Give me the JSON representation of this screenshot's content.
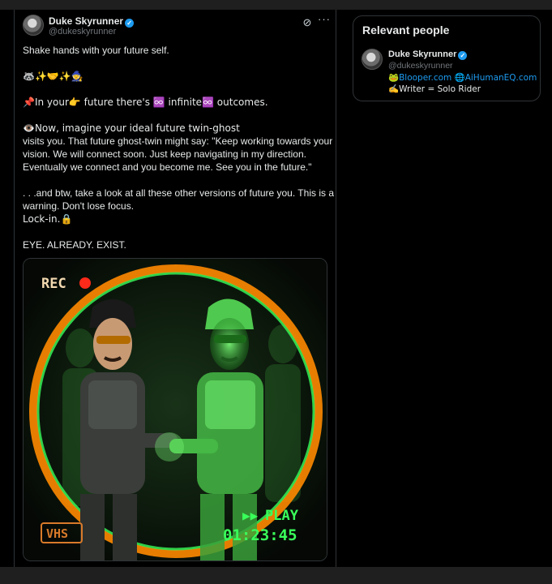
{
  "post": {
    "author_name": "Duke Skyrunner",
    "author_handle": "@dukeskyrunner",
    "grok_icon": "grok-icon",
    "more_icon": "more-icon",
    "lines": [
      "Shake hands with your future self.",
      "🦝✨🤝✨🧙",
      "📌In your👉 future there's ♾️ infinite♾️ outcomes.",
      "👁️Now, imagine your ideal future twin-ghost",
      "visits you. That future ghost-twin might say: \"Keep working towards your",
      "vision. We will connect soon. Just keep navigating in my direction.",
      "Eventually we connect and you become me. See you in the future.\"",
      ". . .and btw, take a look at all these other versions of future you. This is a",
      "warning. Don't lose focus.",
      "Lock-in.🔒",
      "EYE. ALREADY. EXIST."
    ],
    "media": {
      "rec_label": "REC",
      "vhs_label": "VHS",
      "play_label": "PLAY",
      "timecode": "01:23:45"
    }
  },
  "sidebar": {
    "title": "Relevant people",
    "person": {
      "name": "Duke Skyrunner",
      "handle": "@dukeskyrunner",
      "links": "🐸Blooper.com 🌐AiHumanEQ.com",
      "bio": "✍️Writer = Solo Rider"
    }
  },
  "colors": {
    "accent": "#1d9bf0",
    "background": "#000000",
    "border": "#2f3336",
    "glow_green": "#39ff5a",
    "ring_orange": "#ff8a00"
  }
}
